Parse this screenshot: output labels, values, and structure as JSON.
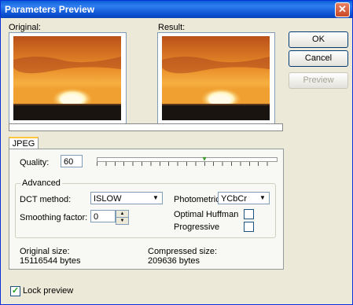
{
  "window": {
    "title": "Parameters Preview",
    "close_glyph": "✕"
  },
  "labels": {
    "original": "Original:",
    "result": "Result:"
  },
  "buttons": {
    "ok": "OK",
    "cancel": "Cancel",
    "preview": "Preview"
  },
  "tab": {
    "label": "JPEG"
  },
  "quality": {
    "label": "Quality:",
    "value": "60",
    "slider_percent": 60
  },
  "advanced": {
    "legend": "Advanced",
    "dct_label": "DCT method:",
    "dct_value": "ISLOW",
    "smoothing_label": "Smoothing factor:",
    "smoothing_value": "0",
    "photometric_label": "Photometric:",
    "photometric_value": "YCbCr",
    "optimal_huffman_label": "Optimal Huffman",
    "optimal_huffman_checked": false,
    "progressive_label": "Progressive",
    "progressive_checked": false
  },
  "sizes": {
    "original_label": "Original size:",
    "original_value": "15116544 bytes",
    "compressed_label": "Compressed size:",
    "compressed_value": "209636 bytes"
  },
  "lock_preview": {
    "label": "Lock preview",
    "checked": true
  },
  "colors": {
    "title_bar": "#0a5fd8",
    "sky_top": "#d4641a",
    "sky_mid": "#f0a030",
    "sun": "#fff8d0",
    "sea": "#1a1410"
  }
}
